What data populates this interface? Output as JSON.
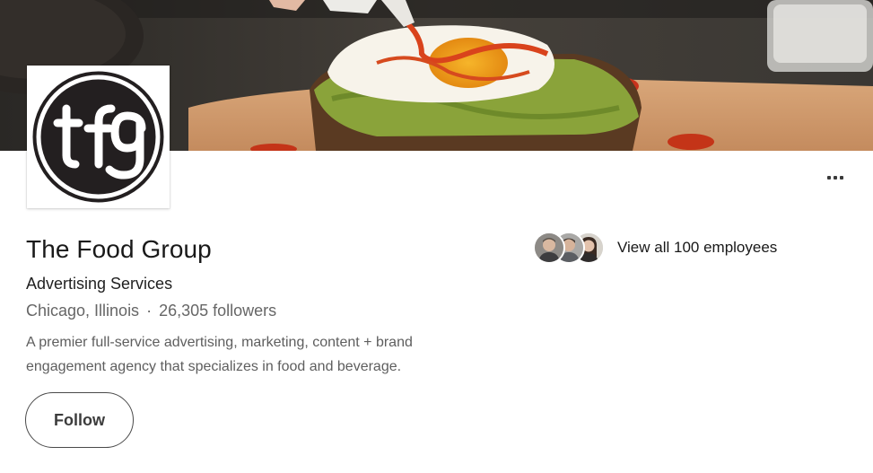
{
  "company": {
    "name": "The Food Group",
    "industry": "Advertising Services",
    "location": "Chicago, Illinois",
    "separator": "·",
    "followers": "26,305 followers",
    "description": "A premier full-service advertising, marketing, content + brand engagement agency that specializes in food and beverage.",
    "logo_text": "tfg"
  },
  "actions": {
    "follow_label": "Follow",
    "more_icon": "ellipsis-icon"
  },
  "employees": {
    "label": "View all 100 employees",
    "avatar_icons": [
      "person-avatar",
      "person-avatar",
      "person-avatar"
    ]
  },
  "colors": {
    "follow_border": "#4a4a4a",
    "muted_text": "#666666",
    "cover_dark": "#2b2a27"
  }
}
